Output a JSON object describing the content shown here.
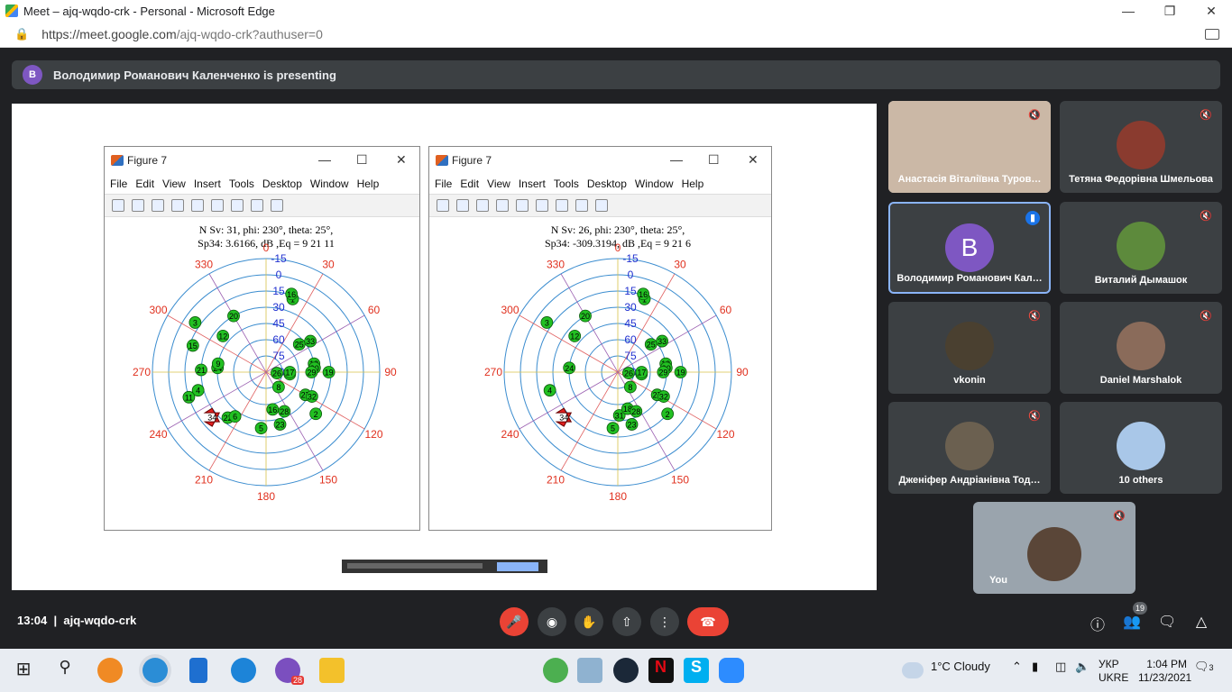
{
  "browser": {
    "title": "Meet – ajq-wqdo-crk - Personal - Microsoft Edge",
    "url_host": "https://meet.google.com",
    "url_path": "/ajq-wqdo-crk?authuser=0"
  },
  "banner": {
    "avatar_letter": "В",
    "text": "Володимир Романович Каленченко is presenting"
  },
  "figures": [
    {
      "title": "Figure 7",
      "menu": [
        "File",
        "Edit",
        "View",
        "Insert",
        "Tools",
        "Desktop",
        "Window",
        "Help"
      ],
      "plot_title_1": "N Sv: 31, phi: 230°, theta: 25°,",
      "plot_title_2": "Sp34: 3.6166, dB ,Eq = 9  21  11"
    },
    {
      "title": "Figure 7",
      "menu": [
        "File",
        "Edit",
        "View",
        "Insert",
        "Tools",
        "Desktop",
        "Window",
        "Help"
      ],
      "plot_title_1": "N Sv: 26, phi: 230°, theta: 25°,",
      "plot_title_2": "Sp34: -309.3194, dB ,Eq = 9  21   6"
    }
  ],
  "chart_data": [
    {
      "type": "scatter",
      "title": "N Sv: 31, phi: 230°, theta: 25°, Sp34: 3.6166, dB ,Eq = 9 21 11",
      "azimuth_ticks": [
        "0",
        "30",
        "60",
        "90",
        "120",
        "150",
        "180",
        "210",
        "240",
        "270",
        "300",
        "330"
      ],
      "elevation_ticks": [
        "-15",
        "0",
        "15",
        "30",
        "45",
        "60",
        "75",
        "90"
      ],
      "points": [
        {
          "label": "1",
          "az": 20,
          "el": 18
        },
        {
          "label": "16",
          "az": 18,
          "el": 14
        },
        {
          "label": "20",
          "az": 330,
          "el": 30
        },
        {
          "label": "12",
          "az": 310,
          "el": 38
        },
        {
          "label": "3",
          "az": 305,
          "el": 10
        },
        {
          "label": "15",
          "az": 290,
          "el": 18
        },
        {
          "label": "24",
          "az": 275,
          "el": 45
        },
        {
          "label": "9",
          "az": 280,
          "el": 45
        },
        {
          "label": "21",
          "az": 272,
          "el": 30
        },
        {
          "label": "4",
          "az": 255,
          "el": 25
        },
        {
          "label": "11",
          "az": 252,
          "el": 15
        },
        {
          "label": "34",
          "az": 230,
          "el": 25
        },
        {
          "label": "22",
          "az": 220,
          "el": 35
        },
        {
          "label": "6",
          "az": 215,
          "el": 40
        },
        {
          "label": "5",
          "az": 185,
          "el": 38
        },
        {
          "label": "16",
          "az": 170,
          "el": 55
        },
        {
          "label": "28",
          "az": 155,
          "el": 50
        },
        {
          "label": "23",
          "az": 165,
          "el": 40
        },
        {
          "label": "8",
          "az": 140,
          "el": 72
        },
        {
          "label": "27",
          "az": 120,
          "el": 48
        },
        {
          "label": "32",
          "az": 118,
          "el": 42
        },
        {
          "label": "2",
          "az": 130,
          "el": 30
        },
        {
          "label": "7",
          "az": 95,
          "el": 68
        },
        {
          "label": "17",
          "az": 90,
          "el": 68
        },
        {
          "label": "26",
          "az": 95,
          "el": 80
        },
        {
          "label": "25",
          "az": 50,
          "el": 50
        },
        {
          "label": "33",
          "az": 55,
          "el": 40
        },
        {
          "label": "13",
          "az": 80,
          "el": 45
        },
        {
          "label": "30",
          "az": 85,
          "el": 45
        },
        {
          "label": "19",
          "az": 90,
          "el": 32
        },
        {
          "label": "29",
          "az": 90,
          "el": 48
        }
      ]
    },
    {
      "type": "scatter",
      "title": "N Sv: 26, phi: 230°, theta: 25°, Sp34: -309.3194, dB ,Eq = 9 21 6",
      "azimuth_ticks": [
        "0",
        "30",
        "60",
        "90",
        "120",
        "150",
        "180",
        "210",
        "240",
        "270",
        "300",
        "330"
      ],
      "elevation_ticks": [
        "-15",
        "0",
        "15",
        "30",
        "45",
        "60",
        "75",
        "90"
      ],
      "points": [
        {
          "label": "1",
          "az": 20,
          "el": 18
        },
        {
          "label": "16",
          "az": 18,
          "el": 14
        },
        {
          "label": "20",
          "az": 330,
          "el": 30
        },
        {
          "label": "12",
          "az": 310,
          "el": 38
        },
        {
          "label": "3",
          "az": 305,
          "el": 10
        },
        {
          "label": "24",
          "az": 275,
          "el": 45
        },
        {
          "label": "4",
          "az": 255,
          "el": 25
        },
        {
          "label": "34",
          "az": 230,
          "el": 25
        },
        {
          "label": "5",
          "az": 185,
          "el": 38
        },
        {
          "label": "31",
          "az": 178,
          "el": 50
        },
        {
          "label": "18",
          "az": 165,
          "el": 55
        },
        {
          "label": "28",
          "az": 155,
          "el": 50
        },
        {
          "label": "23",
          "az": 165,
          "el": 40
        },
        {
          "label": "8",
          "az": 140,
          "el": 72
        },
        {
          "label": "27",
          "az": 120,
          "el": 48
        },
        {
          "label": "32",
          "az": 118,
          "el": 42
        },
        {
          "label": "2",
          "az": 130,
          "el": 30
        },
        {
          "label": "7",
          "az": 95,
          "el": 68
        },
        {
          "label": "17",
          "az": 90,
          "el": 68
        },
        {
          "label": "26",
          "az": 95,
          "el": 80
        },
        {
          "label": "25",
          "az": 50,
          "el": 50
        },
        {
          "label": "33",
          "az": 55,
          "el": 40
        },
        {
          "label": "13",
          "az": 80,
          "el": 45
        },
        {
          "label": "30",
          "az": 85,
          "el": 45
        },
        {
          "label": "19",
          "az": 90,
          "el": 32
        },
        {
          "label": "29",
          "az": 90,
          "el": 48
        }
      ]
    }
  ],
  "participants": [
    {
      "name": "Анастасія Віталіївна Туров…",
      "photo_color": "#b89a86"
    },
    {
      "name": "Тетяна Федорівна Шмельова",
      "photo_color": "#8a3b2f"
    },
    {
      "name": "Володимир Романович Кал…",
      "avatar_letter": "В",
      "photo_color": "#7e57c2",
      "active": true
    },
    {
      "name": "Виталий Дымашок",
      "photo_color": "#5d8a3c"
    },
    {
      "name": "vkonin",
      "photo_color": "#4a4030"
    },
    {
      "name": "Daniel Marshalok",
      "photo_color": "#8a6b5a"
    },
    {
      "name": "Дженіфер Андріанівна Тод…",
      "photo_color": "#6b6050"
    },
    {
      "name": "10 others",
      "photo_color": "#a9c7e8"
    }
  ],
  "self_tile": {
    "name": "You"
  },
  "controls": {
    "time": "13:04",
    "separator": "|",
    "meeting_code": "ajq-wqdo-crk",
    "people_count": "19"
  },
  "taskbar": {
    "weather": "1°C  Cloudy",
    "lang_1": "УКР",
    "lang_2": "UKRE",
    "clock_time": "1:04 PM",
    "clock_date": "11/23/2021",
    "notif_count": "3",
    "viber_badge": "28"
  }
}
